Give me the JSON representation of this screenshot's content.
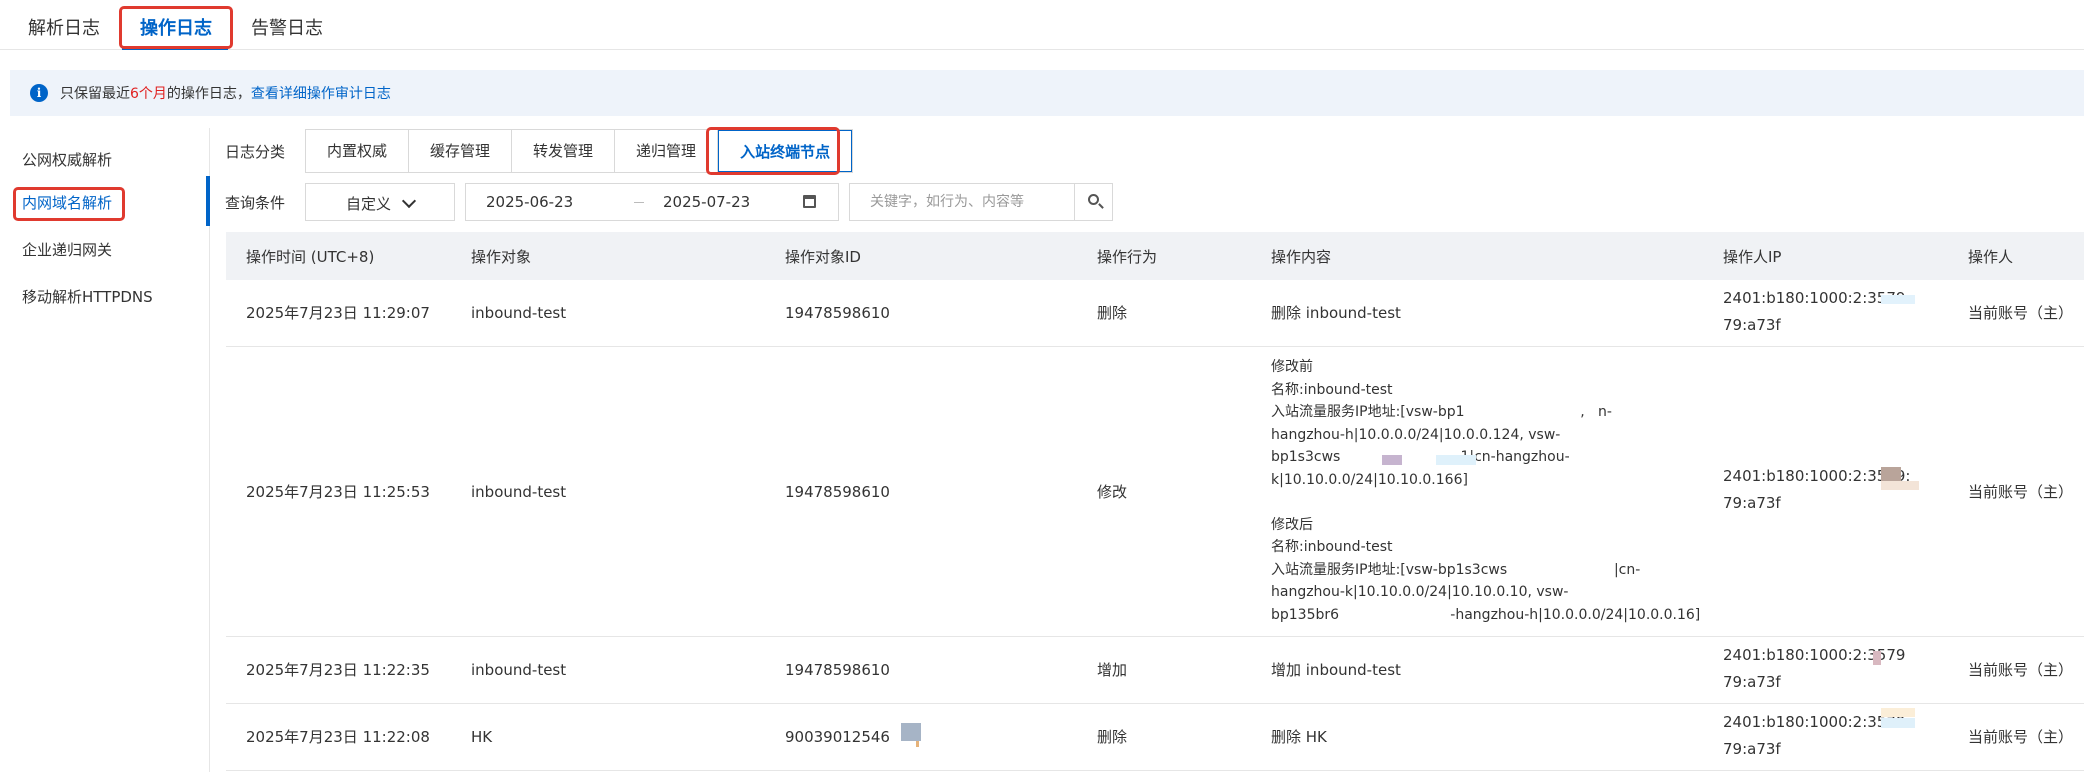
{
  "top_tabs": [
    {
      "label": "解析日志"
    },
    {
      "label": "操作日志"
    },
    {
      "label": "告警日志"
    }
  ],
  "notice": {
    "prefix": "只保留最近",
    "highlight": "6个月",
    "suffix": "的操作日志，",
    "link": "查看详细操作审计日志"
  },
  "left_nav": [
    {
      "label": "公网权威解析"
    },
    {
      "label": "内网域名解析"
    },
    {
      "label": "企业递归网关"
    },
    {
      "label": "移动解析HTTPDNS"
    }
  ],
  "filters": {
    "category_label": "日志分类",
    "categories": [
      "内置权威",
      "缓存管理",
      "转发管理",
      "递归管理",
      "入站终端节点"
    ],
    "query_label": "查询条件",
    "range_select": "自定义",
    "date_start": "2025-06-23",
    "date_end": "2025-07-23",
    "search_placeholder": "关键字，如行为、内容等"
  },
  "table": {
    "columns": [
      "操作时间 (UTC+8)",
      "操作对象",
      "操作对象ID",
      "操作行为",
      "操作内容",
      "操作人IP",
      "操作人"
    ],
    "rows": [
      {
        "time": "2025年7月23日 11:29:07",
        "object": "inbound-test",
        "object_id": "19478598610",
        "action": "删除",
        "content": [
          "删除 inbound-test"
        ],
        "ip": [
          "2401:b180:1000:2:3579:",
          "79:a73f"
        ],
        "operator": "当前账号（主）"
      },
      {
        "time": "2025年7月23日 11:25:53",
        "object": "inbound-test",
        "object_id": "19478598610",
        "action": "修改",
        "content": [
          "修改前",
          "名称:inbound-test",
          "入站流量服务IP地址:[vsw-bp1                          ,   n-",
          "hangzhou-h|10.0.0.0/24|10.0.0.124, vsw-",
          "bp1s3cws                           1|cn-hangzhou-",
          "k|10.10.0.0/24|10.10.0.166]",
          "",
          "修改后",
          "名称:inbound-test",
          "入站流量服务IP地址:[vsw-bp1s3cws                        |cn-",
          "hangzhou-k|10.10.0.0/24|10.10.0.10, vsw-",
          "bp135br6                         -hangzhou-h|10.0.0.0/24|10.0.0.16]"
        ],
        "ip": [
          "2401:b180:1000:2:3579:",
          "79:a73f"
        ],
        "operator": "当前账号（主）"
      },
      {
        "time": "2025年7月23日 11:22:35",
        "object": "inbound-test",
        "object_id": "19478598610",
        "action": "增加",
        "content": [
          "增加 inbound-test"
        ],
        "ip": [
          "2401:b180:1000:2:3579",
          "79:a73f"
        ],
        "operator": "当前账号（主）"
      },
      {
        "time": "2025年7月23日 11:22:08",
        "object": "HK",
        "object_id": "90039012546",
        "action": "删除",
        "content": [
          "删除 HK"
        ],
        "ip": [
          "2401:b180:1000:2:3579:",
          "79:a73f"
        ],
        "operator": "当前账号（主）"
      }
    ]
  },
  "colors": {
    "primary": "#0064c8",
    "highlight_red": "#e02020",
    "annotation_red": "#e03a2f",
    "header_bg": "#f0f2f5",
    "notice_bg": "#eef3fa"
  }
}
